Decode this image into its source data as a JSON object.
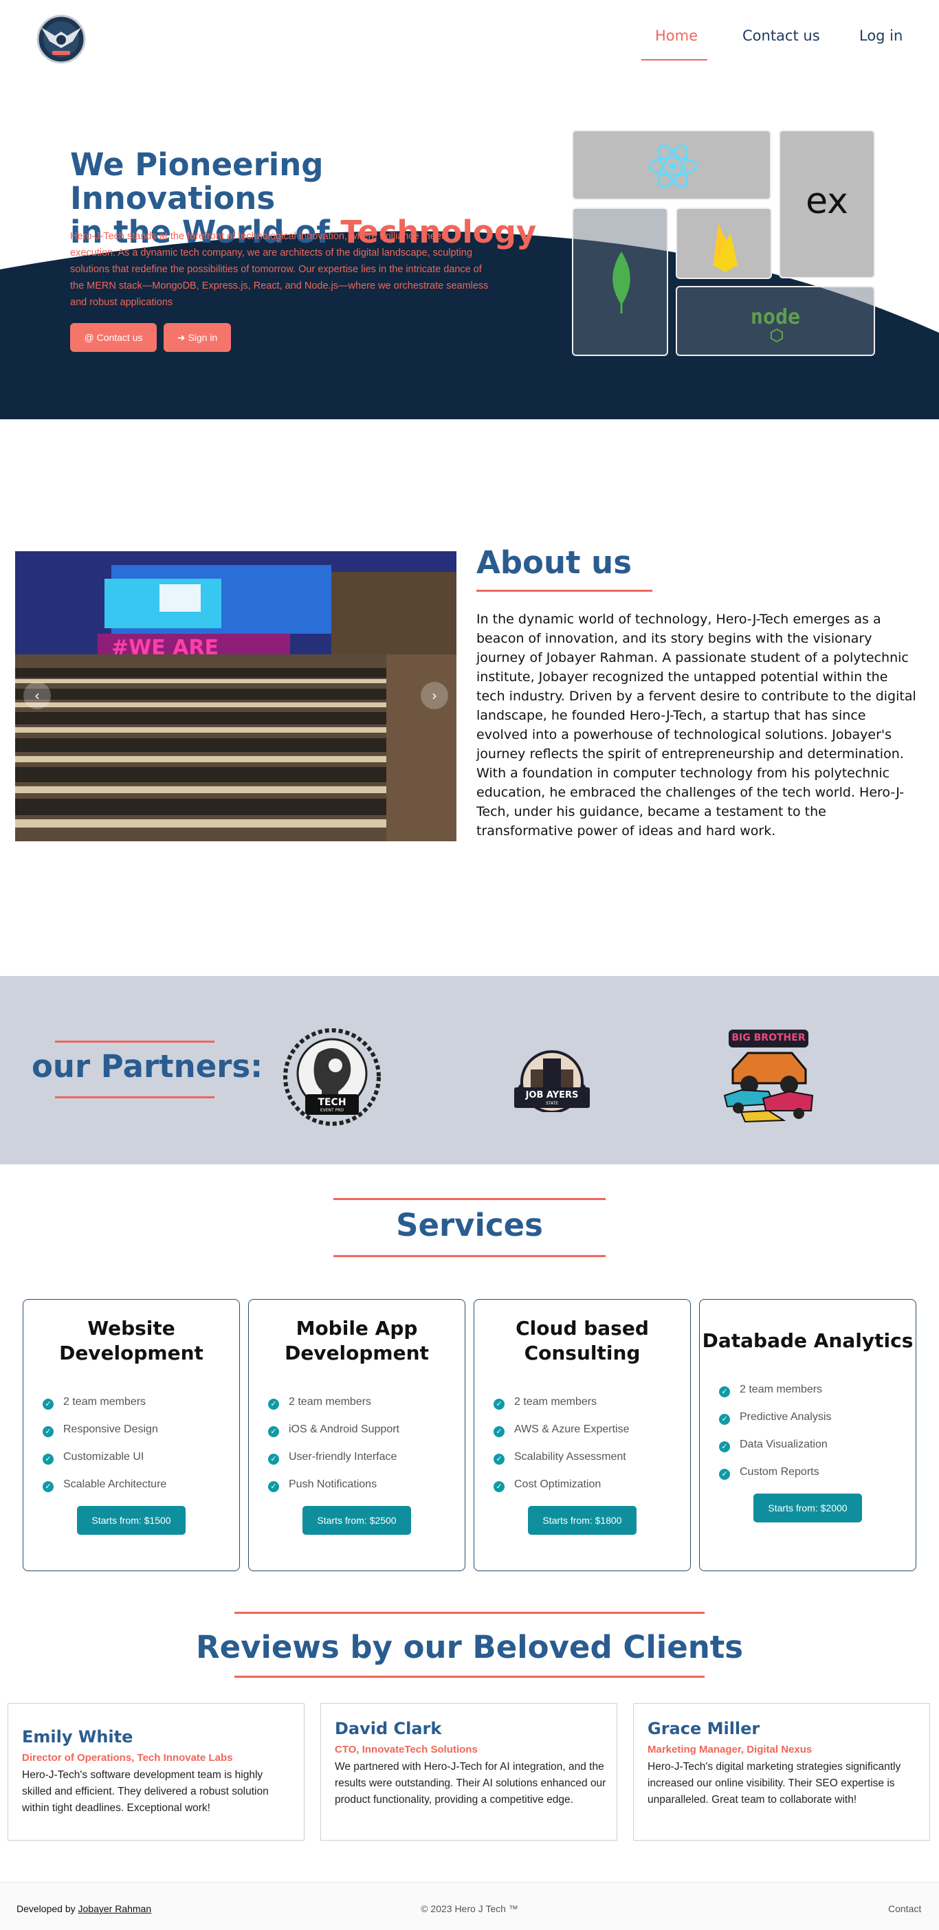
{
  "nav": {
    "links": [
      "Home",
      "Contact us",
      "Log in"
    ]
  },
  "hero": {
    "title_line1": "We Pioneering Innovations",
    "title_line2_prefix": "in the World of ",
    "title_line2_accent": "Technology",
    "description": "Hero-J-Tech stands at the forefront of technological innovation, where brilliance meets execution. As a dynamic tech company, we are architects of the digital landscape, sculpting solutions that redefine the possibilities of tomorrow. Our expertise lies in the intricate dance of the MERN stack—MongoDB, Express.js, React, and Node.js—where we orchestrate seamless and robust applications",
    "contact_button": "Contact us",
    "signin_button": "Sign in",
    "tiles": {
      "express_label": "ex",
      "node_label": "node"
    },
    "colors": {
      "navy": "#0f2740",
      "accent": "#f0665a"
    }
  },
  "about": {
    "title": "About us",
    "text": "In the dynamic world of technology, Hero-J-Tech emerges as a beacon of innovation, and its story begins with the visionary journey of Jobayer Rahman. A passionate student of a polytechnic institute, Jobayer recognized the untapped potential within the tech industry. Driven by a fervent desire to contribute to the digital landscape, he founded Hero-J-Tech, a startup that has since evolved into a powerhouse of technological solutions. Jobayer's journey reflects the spirit of entrepreneurship and determination. With a foundation in computer technology from his polytechnic education, he embraced the challenges of the tech world. Hero-J-Tech, under his guidance, became a testament to the transformative power of ideas and hard work."
  },
  "partners": {
    "title": "our Partners:",
    "logos": [
      {
        "name": "TECH",
        "sub": "EVENT PRO"
      },
      {
        "name": "JOB AYERS",
        "sub": "STATE"
      },
      {
        "name": "BIG BROTHER",
        "sub": ""
      }
    ]
  },
  "services": {
    "title": "Services",
    "cards": [
      {
        "title_line1": "Website",
        "title_line2": "Development",
        "features": [
          "2 team members",
          "Responsive Design",
          "Customizable UI",
          "Scalable Architecture"
        ],
        "button": "Starts from: $1500"
      },
      {
        "title_line1": "Mobile App",
        "title_line2": "Development",
        "features": [
          "2 team members",
          "iOS & Android Support",
          "User-friendly Interface",
          "Push Notifications"
        ],
        "button": "Starts from: $2500"
      },
      {
        "title_line1": "Cloud based",
        "title_line2": "Consulting",
        "features": [
          "2 team members",
          "AWS & Azure Expertise",
          "Scalability Assessment",
          "Cost Optimization"
        ],
        "button": "Starts from: $1800"
      },
      {
        "title_line1": "Databade Analytics",
        "title_line2": "",
        "features": [
          "2 team members",
          "Predictive Analysis",
          "Data Visualization",
          "Custom Reports"
        ],
        "button": "Starts from: $2000"
      }
    ]
  },
  "reviews": {
    "title": "Reviews by our Beloved Clients",
    "items": [
      {
        "name": "Emily White",
        "role": "Director of Operations, Tech Innovate Labs",
        "text": "Hero-J-Tech's software development team is highly skilled and efficient. They delivered a robust solution within tight deadlines. Exceptional work!"
      },
      {
        "name": "David Clark",
        "role": "CTO, InnovateTech Solutions",
        "text": "We partnered with Hero-J-Tech for AI integration, and the results were outstanding. Their AI solutions enhanced our product functionality, providing a competitive edge."
      },
      {
        "name": "Grace Miller",
        "role": "Marketing Manager, Digital Nexus",
        "text": "Hero-J-Tech's digital marketing strategies significantly increased our online visibility. Their SEO expertise is unparalleled. Great team to collaborate with!"
      }
    ]
  },
  "footer": {
    "developed_by": "Developed by ",
    "developer": "Jobayer Rahman",
    "copyright": "© 2023 Hero J Tech ™",
    "contact": "Contact"
  }
}
